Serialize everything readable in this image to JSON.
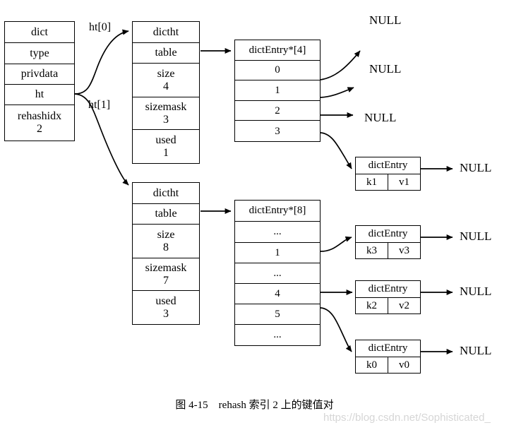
{
  "figure": {
    "caption": "图 4-15　rehash 索引 2 上的键值对",
    "watermark": "https://blog.csdn.net/Sophisticated_"
  },
  "dict": {
    "title": "dict",
    "fields": [
      {
        "name": "type",
        "value": ""
      },
      {
        "name": "privdata",
        "value": ""
      },
      {
        "name": "ht",
        "value": ""
      },
      {
        "name": "rehashidx",
        "value": "2"
      }
    ]
  },
  "pointers": {
    "ht0_label": "ht[0]",
    "ht1_label": "ht[1]"
  },
  "ht0": {
    "title": "dictht",
    "fields": [
      {
        "name": "table",
        "value": ""
      },
      {
        "name": "size",
        "value": "4"
      },
      {
        "name": "sizemask",
        "value": "3"
      },
      {
        "name": "used",
        "value": "1"
      }
    ],
    "table": {
      "title": "dictEntry*[4]",
      "slots": [
        "0",
        "1",
        "2",
        "3"
      ]
    }
  },
  "ht1": {
    "title": "dictht",
    "fields": [
      {
        "name": "table",
        "value": ""
      },
      {
        "name": "size",
        "value": "8"
      },
      {
        "name": "sizemask",
        "value": "7"
      },
      {
        "name": "used",
        "value": "3"
      }
    ],
    "table": {
      "title": "dictEntry*[8]",
      "slots": [
        "...",
        "1",
        "...",
        "4",
        "5",
        "..."
      ]
    }
  },
  "entries": [
    {
      "title": "dictEntry",
      "key": "k1",
      "value": "v1",
      "next": "NULL"
    },
    {
      "title": "dictEntry",
      "key": "k3",
      "value": "v3",
      "next": "NULL"
    },
    {
      "title": "dictEntry",
      "key": "k2",
      "value": "v2",
      "next": "NULL"
    },
    {
      "title": "dictEntry",
      "key": "k0",
      "value": "v0",
      "next": "NULL"
    }
  ],
  "null_labels": [
    {
      "text": "NULL"
    },
    {
      "text": "NULL"
    },
    {
      "text": "NULL"
    }
  ]
}
